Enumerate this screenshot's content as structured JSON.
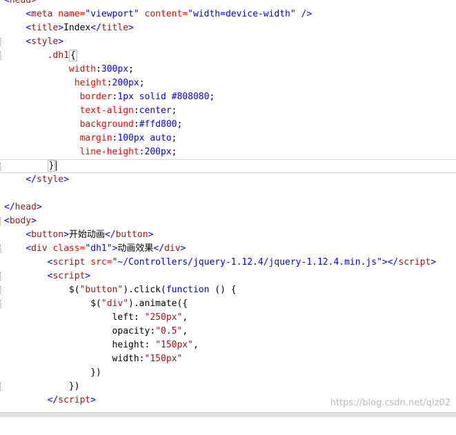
{
  "code": {
    "l0_head_open": "head>",
    "l1_meta_tag": "meta",
    "l1_meta_attr1": "name=",
    "l1_meta_val1": "\"viewport\"",
    "l1_meta_attr2": "content=",
    "l1_meta_val2": "\"width=device-width\"",
    "l1_meta_close": "/>",
    "l2_title_open": "title",
    "l2_title_text": "Index",
    "l2_title_close": "title",
    "l3_style_open": "style",
    "l4_selector": ".dh1",
    "l5_prop": "width",
    "l5_val": "300px",
    "l6_prop": "height",
    "l6_val": "200px",
    "l7_prop": "border",
    "l7_val": "1px solid #808080",
    "l8_prop": "text-align",
    "l8_val": "center",
    "l9_prop": "background",
    "l9_val": "#ffd800",
    "l10_prop": "margin",
    "l10_val": "100px auto",
    "l11_prop": "line-height",
    "l11_val": "200px",
    "l13_style_close": "style",
    "l15_head_close": "head",
    "l16_body_open": "body",
    "l17_button_tag": "button",
    "l17_button_text": "开始动画",
    "l18_div_tag": "div",
    "l18_div_attr": "class=",
    "l18_div_val": "\"dh1\"",
    "l18_div_text": "动画效果",
    "l19_script_tag": "script",
    "l19_src_attr": "src=",
    "l19_src_val": "\"~/Controllers/jquery-1.12.4/jquery-1.12.4.min.js\"",
    "l20_script_tag": "script",
    "l21_sel_a": "$(",
    "l21_sel_str": "\"button\"",
    "l21_sel_b": ").click(",
    "l21_function": "function",
    "l21_sel_c": " () {",
    "l22_a": "$(",
    "l22_str": "\"div\"",
    "l22_b": ").animate({",
    "l23_key": "left: ",
    "l23_val": "\"250px\"",
    "l24_key": "opacity:",
    "l24_val": "\"0.5\"",
    "l25_key": "height: ",
    "l25_val": "\"150px\"",
    "l26_key": "width:",
    "l26_val": "\"150px\"",
    "l27": "})",
    "l28": "})",
    "l29_script_close": "script"
  },
  "watermark": "https://blog.csdn.net/qiz02"
}
